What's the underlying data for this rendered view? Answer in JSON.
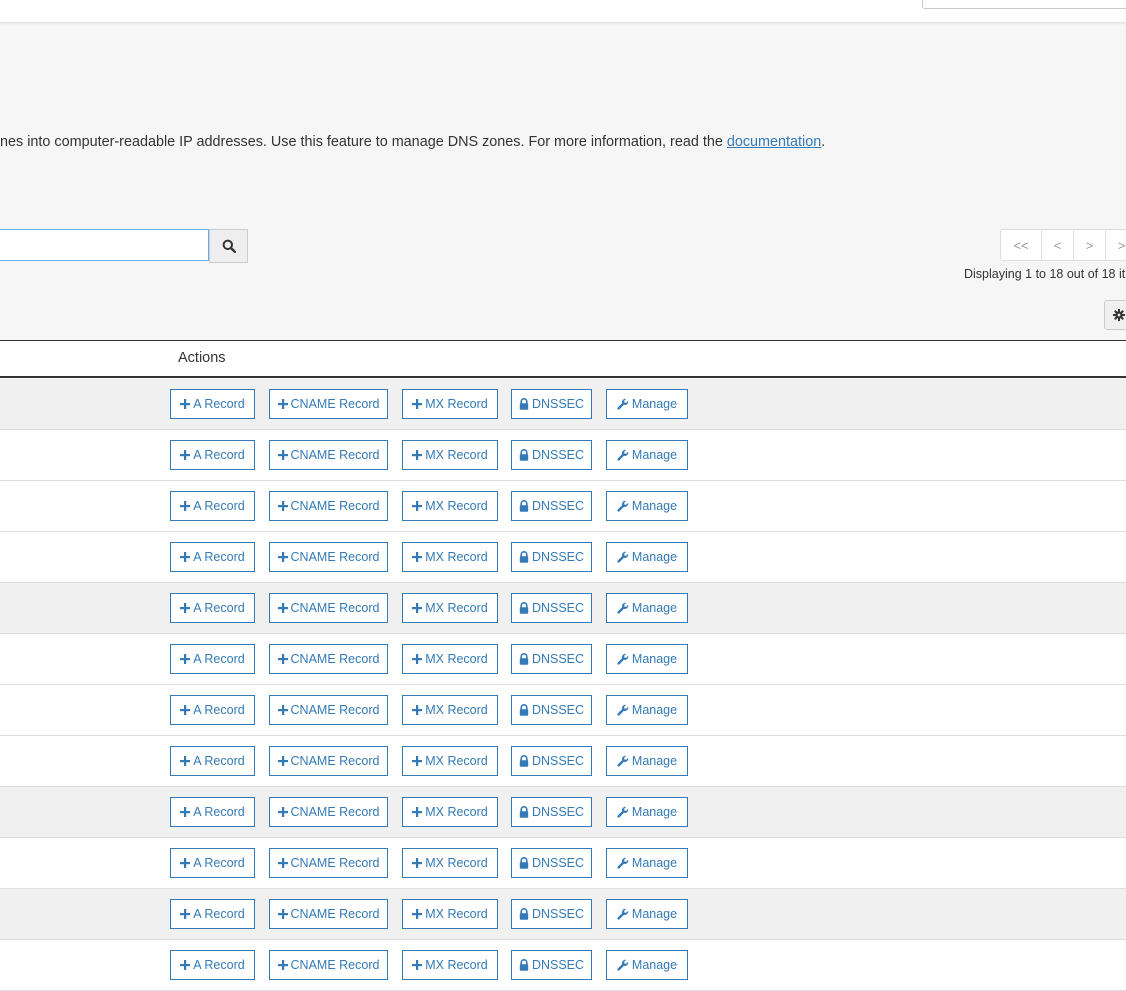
{
  "description": {
    "text": "nes into computer-readable IP addresses. Use this feature to manage DNS zones. For more information, read the ",
    "link": "documentation",
    "end": "."
  },
  "search": {
    "value": "",
    "placeholder": "",
    "button_icon": "search-icon"
  },
  "pagination": {
    "first": "<<",
    "prev": "<",
    "next": ">",
    "last": ">",
    "info": "Displaying 1 to 18 out of 18 it"
  },
  "settings": {
    "icon": "gear-icon"
  },
  "table": {
    "actions_header": "Actions",
    "action_labels": {
      "a_record": "A Record",
      "cname_record": "CNAME Record",
      "mx_record": "MX Record",
      "dnssec": "DNSSEC",
      "manage": "Manage"
    },
    "row_shading": [
      "alt",
      "",
      "",
      "",
      "alt",
      "",
      "",
      "",
      "alt",
      "",
      "alt",
      ""
    ]
  },
  "colors": {
    "link": "#337ab7",
    "button_border": "#337ab7",
    "row_alt": "#f0f0f0",
    "background": "#f6f6f6"
  }
}
